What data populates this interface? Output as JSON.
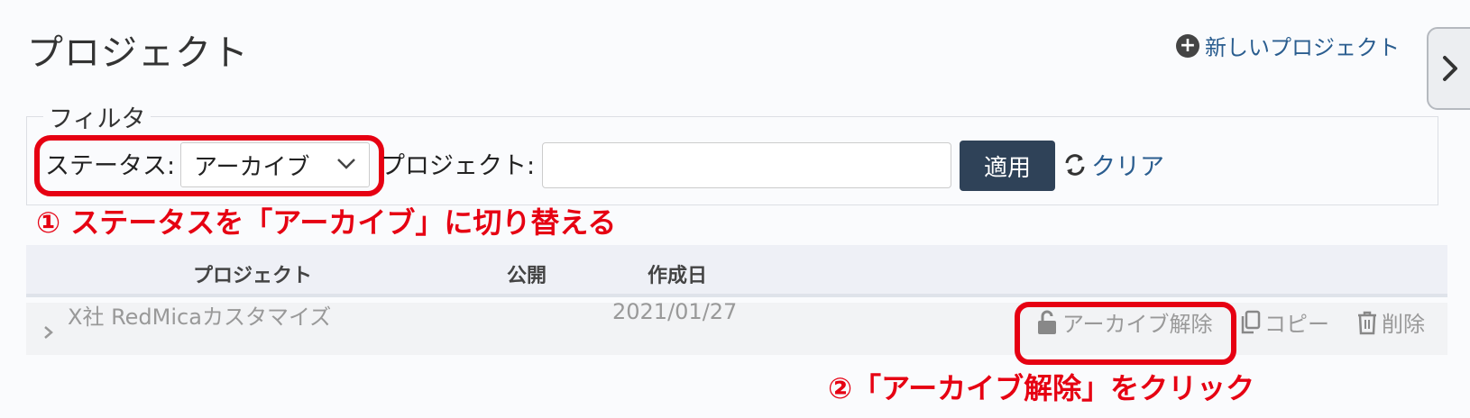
{
  "page": {
    "title": "プロジェクト"
  },
  "header": {
    "new_project_label": "新しいプロジェクト"
  },
  "filter": {
    "legend": "フィルタ",
    "status_label": "ステータス:",
    "status_value": "アーカイブ",
    "project_label": "プロジェクト:",
    "project_value": "",
    "apply_label": "適用",
    "clear_label": "クリア"
  },
  "annotations": {
    "step1": "① ステータスを「アーカイブ」に切り替える",
    "step2": "②「アーカイブ解除」をクリック",
    "highlight_color": "#e60012"
  },
  "table": {
    "columns": [
      "プロジェクト",
      "公開",
      "作成日"
    ],
    "rows": [
      {
        "name": "X社 RedMicaカスタマイズ",
        "created": "2021/01/27",
        "actions": {
          "unarchive": "アーカイブ解除",
          "copy": "コピー",
          "delete": "削除"
        }
      }
    ]
  },
  "icons": [
    "plus-circle-icon",
    "chevron-right-icon",
    "chevron-down-icon",
    "refresh-icon",
    "unlock-icon",
    "copy-icon",
    "trash-icon"
  ],
  "colors": {
    "apply_button": "#2f4258",
    "link": "#2a5d8f"
  }
}
